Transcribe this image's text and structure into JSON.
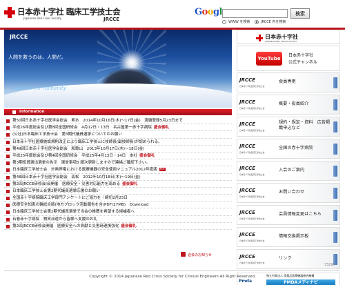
{
  "header": {
    "org_title": "日本赤十字社  臨床工学技士会",
    "org_sub": "Japanese Red Cross Society",
    "org_abbr": "JRCCE"
  },
  "search": {
    "logo_letters": [
      "G",
      "o",
      "o",
      "g",
      "l",
      "e"
    ],
    "placeholder": "",
    "button_label": "検索",
    "option_www": "WWW を検索",
    "option_site": "JRCCE 内を検索",
    "selected": "site"
  },
  "banner": {
    "title": "JRCCE",
    "tagline": "人間を救うのは、人間だ。",
    "caption": "Together for humanity"
  },
  "info": {
    "header_label": "Information",
    "news": [
      {
        "text": "第50回日本赤十字社医学会総会　熊本　2014年10月16日(木)～17日(金)　演題登録5月23日まで",
        "badge": "",
        "pdf": ""
      },
      {
        "text": "平成26年度総会及び第8回全国研修会　4月12日・13日　名古屋第一赤十字病院",
        "badge": "盛会御礼",
        "pdf": ""
      },
      {
        "text": "(公社)日本臨床工学技士会　第3期代議員選挙についてのお願い",
        "badge": "",
        "pdf": ""
      },
      {
        "text": "日本赤十字社医療施設規則改正により臨床工学技士に技師長(副技師長)が認められる。",
        "badge": "",
        "pdf": ""
      },
      {
        "text": "第49回日本赤十字社医学会総会　和歌山　2013年10月17日(木)～18日(金)",
        "badge": "",
        "pdf": ""
      },
      {
        "text": "平成25年度総会及び第4回全国研修会　平成25年4月13日・14日　本社",
        "badge": "盛会御礼",
        "pdf": ""
      },
      {
        "text": "第3期役員選出選挙の告示　選挙事項3 順次更新しますので連絡ご確認下さい。",
        "badge": "",
        "pdf": ""
      },
      {
        "text": "日本臨床工学技士会　計画停電における医療機器の安全使用マニュアル2012年度版",
        "badge": "",
        "pdf": "PDF"
      },
      {
        "text": "第48回日本赤十字社医学会総会　高松　2012年10月18日(木)～19日(金)",
        "badge": "",
        "pdf": ""
      },
      {
        "text": "第2回JRCCE研修会Ⅰ会開催　医療安全・災害対応能力を高める",
        "badge": "盛会御礼",
        "pdf": ""
      },
      {
        "text": "日本臨床工学技士会第2期代議員選挙応援のお願い",
        "badge": "",
        "pdf": ""
      },
      {
        "text": "全国赤十字病院臨床工学部門アンケートにご協力を｜締切2月25日",
        "badge": "",
        "pdf": ""
      },
      {
        "text": "医療安全知恵の輪総合版(地方ブロック活動報告を含)PDF(27MB)　Download",
        "badge": "",
        "pdf": ""
      },
      {
        "text": "日本臨床工学技士会第2期代議員選挙で当会の推薦を希望する候補者へ",
        "badge": "",
        "pdf": ""
      },
      {
        "text": "石巻赤十字病院　物資派遣から皆様へ支援のお礼",
        "badge": "",
        "pdf": ""
      },
      {
        "text": "第2回JRCCE研修会開催　医療安全への貢献と災害時連携強化",
        "badge": "盛会御礼",
        "pdf": ""
      }
    ],
    "past_link": "過去のお知らせ"
  },
  "sidebar": {
    "jrc_title": "日本赤十字社",
    "jrc_sub": "JAPANESE RED CROSS SOCIETY",
    "youtube_logo": "YouTube",
    "youtube_line1": "日本赤十字社",
    "youtube_line2": "公式チャンネル",
    "menu": [
      {
        "brand": "JRCCE",
        "sub": "日本赤十字社臨床工学技士会",
        "label": "会員専用"
      },
      {
        "brand": "JRCCE",
        "sub": "日本赤十字社臨床工学技士会",
        "label": "概要・役員紹介"
      },
      {
        "brand": "JRCCE",
        "sub": "日本赤十字社臨床工学技士会",
        "label": "規約・規定・資料　広告掲載申込など"
      },
      {
        "brand": "JRCCE",
        "sub": "日本赤十字社臨床工学技士会",
        "label": "全国の赤十字病院"
      },
      {
        "brand": "JRCCE",
        "sub": "日本赤十字社臨床工学技士会",
        "label": "入会のご案内"
      },
      {
        "brand": "JRCCE",
        "sub": "日本赤十字社臨床工学技士会",
        "label": "お問い合わせ"
      },
      {
        "brand": "JRCCE",
        "sub": "日本赤十字社臨床工学技士会",
        "label": "会員情報変更はこちら"
      },
      {
        "brand": "JRCCE",
        "sub": "日本赤十字社臨床工学技士会",
        "label": "情報交換掲示板"
      },
      {
        "brand": "JRCCE",
        "sub": "日本赤十字社臨床工学技士会",
        "label": "リンク"
      }
    ],
    "pmda_name": "Pmda",
    "pmda_top": "独立行政法人 医薬品医療機器総合機構",
    "pmda_box": "PMDAメディナビ"
  },
  "footer": {
    "counter": "73296",
    "copyright": "Copyright © 2014  Japanese Red Cross Society for Clinical Engineers  All Right Reserved."
  },
  "colors": {
    "brand_red": "#c0141d",
    "arrow_blue": "#3f6fb3"
  }
}
